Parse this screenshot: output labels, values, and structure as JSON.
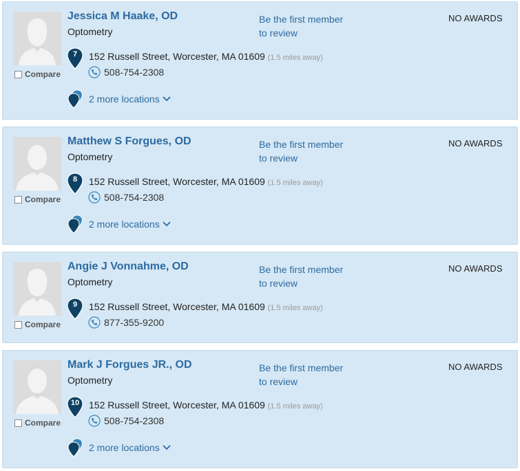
{
  "doctors": [
    {
      "name": "Jessica M Haake, OD",
      "specialty": "Optometry",
      "review_line1": "Be the first member",
      "review_line2": "to review",
      "awards": "NO AWARDS",
      "pin_number": "7",
      "address": "152 Russell Street, Worcester, MA 01609",
      "distance": "(1.5 miles away)",
      "phone": "508-754-2308",
      "more_locations": "2 more locations",
      "compare_label": "Compare"
    },
    {
      "name": "Matthew S Forgues, OD",
      "specialty": "Optometry",
      "review_line1": "Be the first member",
      "review_line2": "to review",
      "awards": "NO AWARDS",
      "pin_number": "8",
      "address": "152 Russell Street, Worcester, MA 01609",
      "distance": "(1.5 miles away)",
      "phone": "508-754-2308",
      "more_locations": "2 more locations",
      "compare_label": "Compare"
    },
    {
      "name": "Angie J Vonnahme, OD",
      "specialty": "Optometry",
      "review_line1": "Be the first member",
      "review_line2": "to review",
      "awards": "NO AWARDS",
      "pin_number": "9",
      "address": "152 Russell Street, Worcester, MA 01609",
      "distance": "(1.5 miles away)",
      "phone": "877-355-9200",
      "compare_label": "Compare"
    },
    {
      "name": "Mark J Forgues JR., OD",
      "specialty": "Optometry",
      "review_line1": "Be the first member",
      "review_line2": "to review",
      "awards": "NO AWARDS",
      "pin_number": "10",
      "address": "152 Russell Street, Worcester, MA 01609",
      "distance": "(1.5 miles away)",
      "phone": "508-754-2308",
      "more_locations": "2 more locations",
      "compare_label": "Compare"
    }
  ],
  "colors": {
    "card_bg": "#d6e8f5",
    "link": "#2d6aa0",
    "pin": "#0f4163",
    "pin_light": "#3a86bd"
  },
  "icons": {
    "avatar": "silhouette-avatar-icon",
    "pin": "map-pin-icon",
    "phone": "phone-icon",
    "more": "multi-pin-icon",
    "chevron": "chevron-down-icon"
  }
}
